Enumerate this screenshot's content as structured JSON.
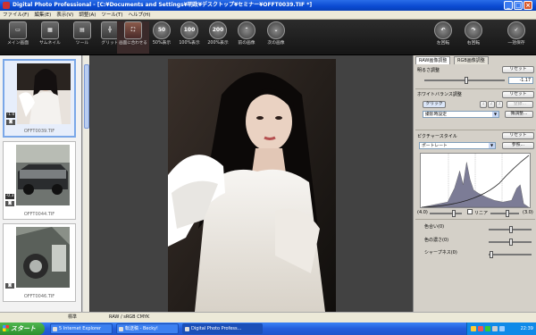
{
  "window": {
    "title": "Digital Photo Professional - [C:¥Documents and Settings¥明政¥デスクトップ¥セミナー¥OFFT0039.TIF *]",
    "buttons": [
      "_",
      "□",
      "×"
    ]
  },
  "menubar": [
    "ファイル(F)",
    "編集(E)",
    "表示(V)",
    "調整(A)",
    "ツール(T)",
    "ヘルプ(H)"
  ],
  "toolbar": {
    "left": [
      {
        "label": "メイン画面",
        "icon": "folder-icon"
      },
      {
        "label": "サムネイル",
        "icon": "grid-icon"
      },
      {
        "label": "ツール",
        "icon": "tool-icon"
      },
      {
        "label": "グリッド",
        "icon": "grid-lines-icon"
      },
      {
        "label": "画面に合わせる",
        "icon": "fit-screen-icon"
      },
      {
        "label": "50%表示",
        "icon": "zoom-50-icon",
        "text": "50"
      },
      {
        "label": "100%表示",
        "icon": "zoom-100-icon",
        "text": "100"
      },
      {
        "label": "200%表示",
        "icon": "zoom-200-icon",
        "text": "200"
      },
      {
        "label": "前の画像",
        "icon": "prev-image-icon",
        "text": "⌃"
      },
      {
        "label": "次の画像",
        "icon": "next-image-icon",
        "text": "⌄"
      }
    ],
    "right": [
      {
        "label": "左回転",
        "icon": "rotate-left-icon",
        "text": "↶"
      },
      {
        "label": "右回転",
        "icon": "rotate-right-icon",
        "text": "↷"
      },
      {
        "label": "一括保存",
        "icon": "batch-save-icon",
        "text": "✓"
      }
    ]
  },
  "thumbnails": [
    {
      "filename": "OFFT0039.TIF",
      "badge": "-1.0",
      "selected": true
    },
    {
      "filename": "OFFT0044.TIF",
      "badge": "-0.3",
      "selected": false
    },
    {
      "filename": "OFFT0046.TIF",
      "badge": "",
      "selected": false
    }
  ],
  "panel": {
    "tabs": [
      "RAW画像調整",
      "RGB画像調整"
    ],
    "brightness": {
      "title": "明るさ調整",
      "reset": "リセット",
      "value": "-1.17"
    },
    "white_balance": {
      "title": "ホワイトバランス調整",
      "reset": "リセット",
      "click": "クリック",
      "nums": [
        "1",
        "2",
        "3"
      ],
      "register": "登録...",
      "preset": "撮影時設定",
      "fine": "微調整..."
    },
    "picture_style": {
      "title": "ピクチャースタイル",
      "reset": "リセット",
      "value": "ポートレート",
      "browse": "参照..."
    },
    "histogram": {
      "min": "(4.0)",
      "linear": "リニア",
      "max": "(3.0)"
    },
    "sliders": [
      {
        "label": "色合い(0)"
      },
      {
        "label": "色の濃さ(0)"
      },
      {
        "label": "シャープネス(0)"
      }
    ]
  },
  "statusbar": {
    "left": "標準",
    "center": "RAW / sRGB  CMYK"
  },
  "taskbar": {
    "start": "スタート",
    "tasks": [
      "5 Internet Explorer",
      "転送稿 - Becky!",
      "Digital Photo Profess..."
    ],
    "clock": "22:39"
  }
}
